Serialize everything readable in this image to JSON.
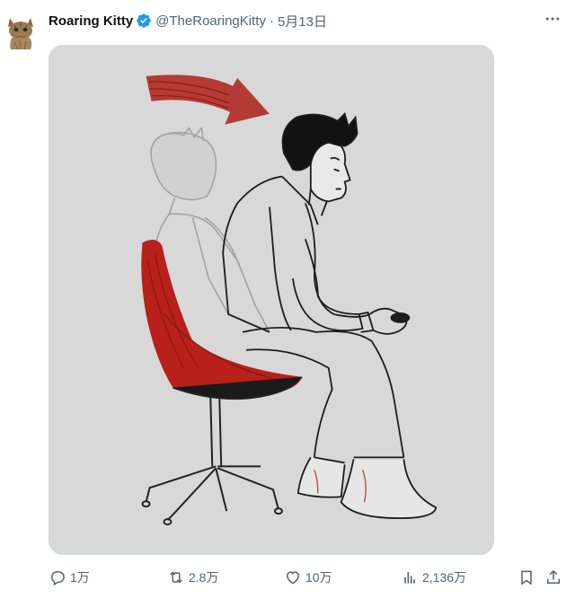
{
  "tweet": {
    "display_name": "Roaring Kitty",
    "handle": "@TheRoaringKitty",
    "separator": "·",
    "date": "5月13日"
  },
  "icons": {
    "verified": "verified-badge-icon",
    "more": "more-icon",
    "reply": "reply-icon",
    "retweet": "retweet-icon",
    "like": "like-icon",
    "views": "views-icon",
    "bookmark": "bookmark-icon",
    "share": "share-icon"
  },
  "colors": {
    "verified": "#1d9bf0",
    "muted": "#536471",
    "chair_red": "#b8201a"
  },
  "metrics": {
    "replies": "1万",
    "retweets": "2.8万",
    "likes": "10万",
    "views": "2,136万"
  }
}
